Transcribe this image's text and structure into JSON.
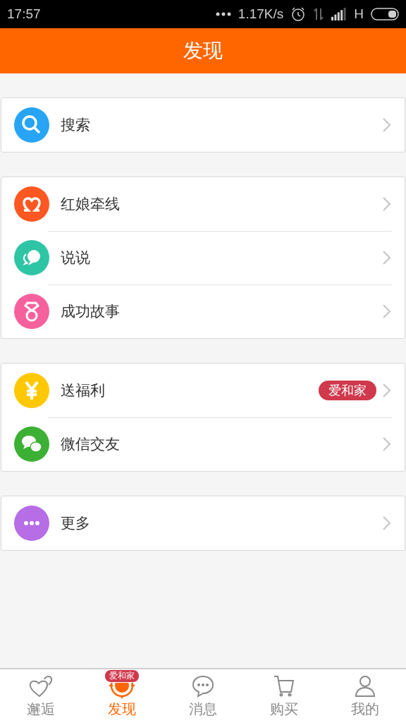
{
  "status_bar": {
    "time": "17:57",
    "speed": "1.17K/s",
    "network": "H"
  },
  "header": {
    "title": "发现"
  },
  "groups": [
    {
      "items": [
        {
          "label": "搜索",
          "kind": "search",
          "color": "#27a4f4"
        }
      ]
    },
    {
      "items": [
        {
          "label": "红娘牵线",
          "kind": "matchmaker",
          "color": "#ff5722"
        },
        {
          "label": "说说",
          "kind": "chat",
          "color": "#2ec5a5"
        },
        {
          "label": "成功故事",
          "kind": "ring",
          "color": "#f6619d"
        }
      ]
    },
    {
      "items": [
        {
          "label": "送福利",
          "kind": "yen",
          "color": "#ffc800",
          "badge": "爱和家"
        },
        {
          "label": "微信交友",
          "kind": "wechat",
          "color": "#3cb034"
        }
      ]
    },
    {
      "items": [
        {
          "label": "更多",
          "kind": "more",
          "color": "#b66de6"
        }
      ]
    }
  ],
  "tabbar": [
    {
      "label": "邂逅",
      "kind": "hearts",
      "selected": false
    },
    {
      "label": "发现",
      "kind": "target",
      "selected": true,
      "badge": "爱和家"
    },
    {
      "label": "消息",
      "kind": "message",
      "selected": false
    },
    {
      "label": "购买",
      "kind": "cart",
      "selected": false
    },
    {
      "label": "我的",
      "kind": "person",
      "selected": false
    }
  ]
}
